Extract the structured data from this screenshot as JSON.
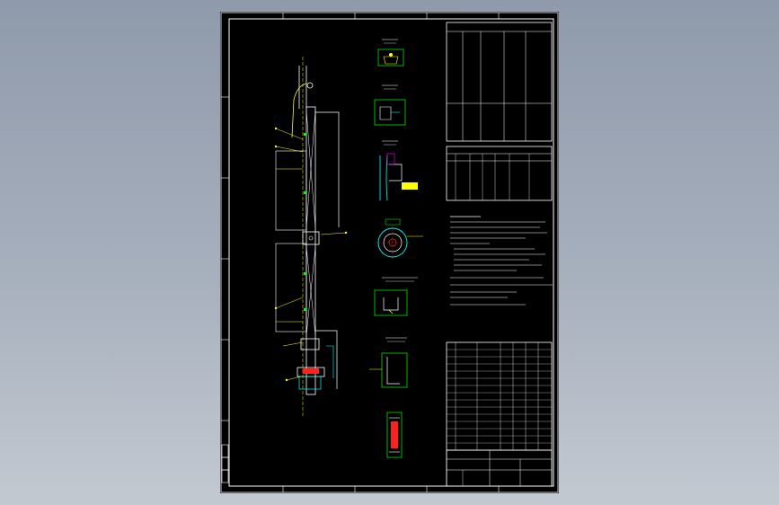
{
  "colors": {
    "background": "#98a3b2",
    "sheet": "#000000",
    "frame": "#ffffff",
    "accent_yellow": "#ffff00",
    "accent_cyan": "#00ffff",
    "accent_green": "#00ff00",
    "accent_red": "#ff2020",
    "accent_magenta": "#ff00ff"
  },
  "drawing": {
    "icon": "cad-drawing-icon"
  }
}
